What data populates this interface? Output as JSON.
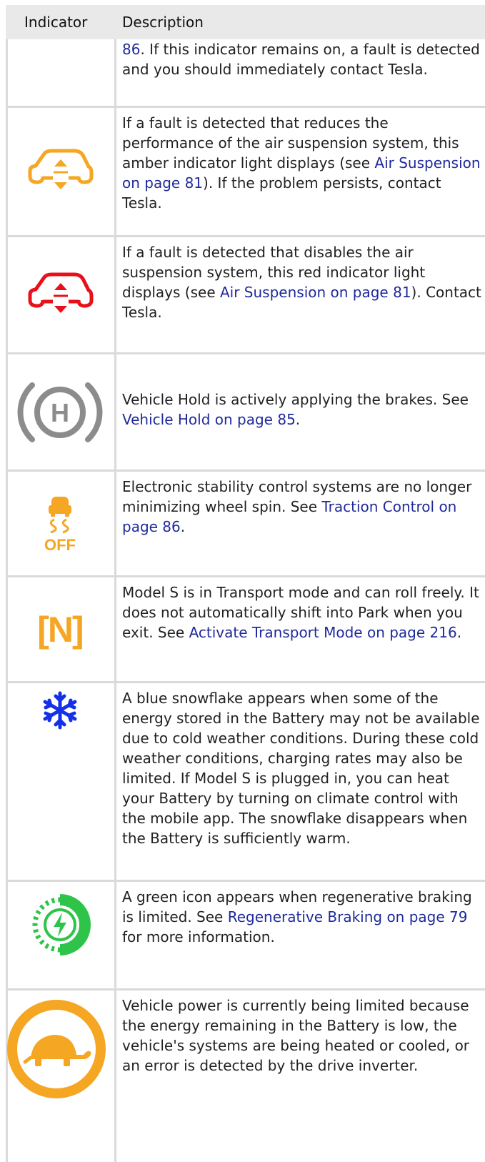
{
  "header": {
    "indicator": "Indicator",
    "description": "Description"
  },
  "colors": {
    "amber": "#f5a623",
    "red": "#e8101a",
    "gray": "#8c8c8c",
    "blue": "#1430e8",
    "green": "#2ec44a",
    "link": "#1f2a9c"
  },
  "rows": [
    {
      "icon": "none",
      "pre": "",
      "link": "86",
      "post": ". If this indicator remains on, a fault is detected and you should immediately contact Tesla."
    },
    {
      "icon": "air-suspension-amber-icon",
      "pre": "If a fault is detected that reduces the performance of the air suspension system, this amber indicator light displays (see ",
      "link": "Air Suspension on page 81",
      "post": "). If the problem persists, contact Tesla."
    },
    {
      "icon": "air-suspension-red-icon",
      "pre": "If a fault is detected that disables the air suspension system, this red indicator light displays (see ",
      "link": "Air Suspension on page 81",
      "post": "). Contact Tesla."
    },
    {
      "icon": "vehicle-hold-icon",
      "pre": "Vehicle Hold is actively applying the brakes. See ",
      "link": "Vehicle Hold on page 85",
      "post": "."
    },
    {
      "icon": "traction-control-off-icon",
      "icon_text": "OFF",
      "pre": "Electronic stability control systems are no longer minimizing wheel spin. See ",
      "link": "Traction Control on page 86",
      "post": "."
    },
    {
      "icon": "transport-mode-icon",
      "icon_text": "[N]",
      "pre": "Model S is in Transport mode and can roll freely. It does not automatically shift into Park when you exit. See ",
      "link": "Activate Transport Mode on page 216",
      "post": "."
    },
    {
      "icon": "snowflake-icon",
      "pre": "A blue snowflake appears when some of the energy stored in the Battery may not be available due to cold weather conditions. During these cold weather conditions, charging rates may also be limited. If Model S is plugged in, you can heat your Battery by turning on climate control with the mobile app. The snowflake disappears when the Battery is sufficiently warm.",
      "link": "",
      "post": ""
    },
    {
      "icon": "regen-braking-limited-icon",
      "pre": "A green icon appears when regenerative braking is limited. See ",
      "link": "Regenerative Braking on page 79",
      "post": " for more information."
    },
    {
      "icon": "turtle-power-limited-icon",
      "pre": "Vehicle power is currently being limited because the energy remaining in the Battery is low, the vehicle's systems are being heated or cooled, or an error is detected by the drive inverter.",
      "link": "",
      "post": ""
    }
  ]
}
